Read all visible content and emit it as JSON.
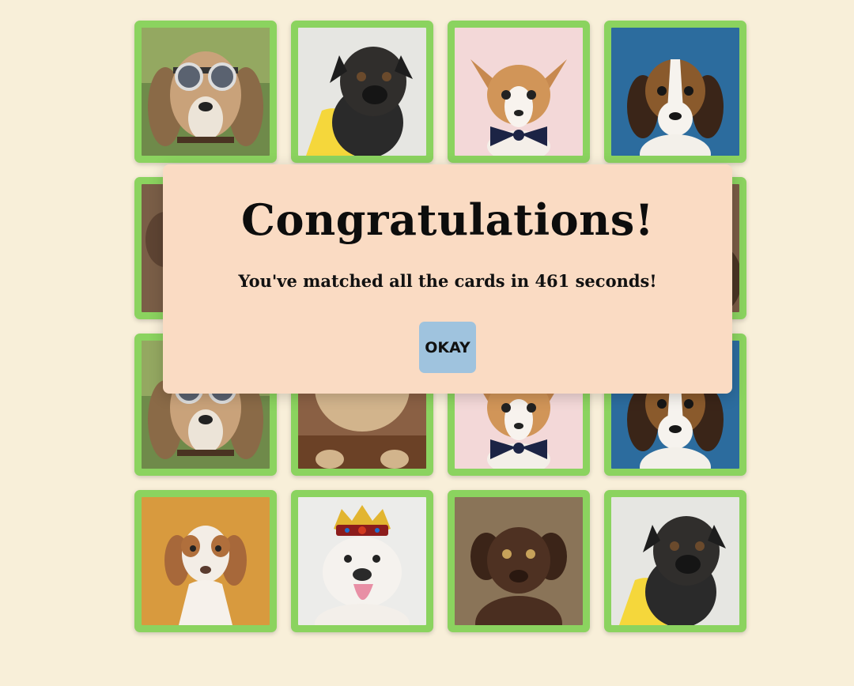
{
  "modal": {
    "title": "Congratulations!",
    "message": "You've matched all the cards in 461 seconds!",
    "button_label": "OKAY"
  },
  "colors": {
    "background": "#f8efd9",
    "card_border": "#8bd35f",
    "modal_background": "#fadbc3",
    "button_background": "#9fc3de"
  },
  "cards": [
    {
      "name": "card-beagle-goggles",
      "dog": "beagle-goggles"
    },
    {
      "name": "card-black-pug",
      "dog": "black-pug"
    },
    {
      "name": "card-chihuahua-bowtie",
      "dog": "chihuahua-bowtie"
    },
    {
      "name": "card-beagle-puppy",
      "dog": "beagle-puppy"
    },
    {
      "name": "card-brown-dog",
      "dog": "brown-dog"
    },
    {
      "name": "card-hidden-2",
      "dog": "hidden"
    },
    {
      "name": "card-hidden-3",
      "dog": "hidden"
    },
    {
      "name": "card-beagle-side",
      "dog": "beagle-side"
    },
    {
      "name": "card-beagle-goggles-2",
      "dog": "beagle-goggles"
    },
    {
      "name": "card-fawn-pug",
      "dog": "fawn-pug"
    },
    {
      "name": "card-chihuahua-bowtie-2",
      "dog": "chihuahua-bowtie"
    },
    {
      "name": "card-beagle-puppy-2",
      "dog": "beagle-puppy"
    },
    {
      "name": "card-hound-orange",
      "dog": "hound-orange"
    },
    {
      "name": "card-bulldog-crown",
      "dog": "bulldog-crown"
    },
    {
      "name": "card-chocolate-lab",
      "dog": "chocolate-lab"
    },
    {
      "name": "card-black-pug-2",
      "dog": "black-pug"
    }
  ]
}
